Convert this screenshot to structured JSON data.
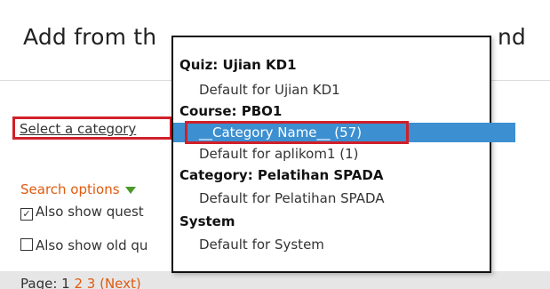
{
  "dialog": {
    "title": "Add from th",
    "title_tail": "nd"
  },
  "category": {
    "label": "Select a category"
  },
  "search": {
    "label": "Search options",
    "icon": "triangle-down-icon",
    "option_1": "Also show quest",
    "option_1_checked": true,
    "option_2": "Also show old qu",
    "option_2_checked": false
  },
  "pager": {
    "prefix": "Page: 1",
    "pages": "2 3",
    "next": "(Next)"
  },
  "dropdown": {
    "items": [
      {
        "type": "group",
        "label": "Quiz: Ujian KD1"
      },
      {
        "type": "item",
        "label": "Default for Ujian KD1"
      },
      {
        "type": "group",
        "label": "Course: PBO1"
      },
      {
        "type": "item",
        "label": "__Category Name__ (57)",
        "selected": true
      },
      {
        "type": "item",
        "label": "Default for aplikom1 (1)"
      },
      {
        "type": "group",
        "label": "Category: Pelatihan SPADA"
      },
      {
        "type": "item",
        "label": "Default for Pelatihan SPADA"
      },
      {
        "type": "group",
        "label": "System"
      },
      {
        "type": "item",
        "label": "Default for System"
      }
    ]
  },
  "colors": {
    "highlight": "#3c8fd0",
    "annotation": "#d0202a",
    "link": "#e05a10",
    "triangle": "#4c9a2a"
  }
}
